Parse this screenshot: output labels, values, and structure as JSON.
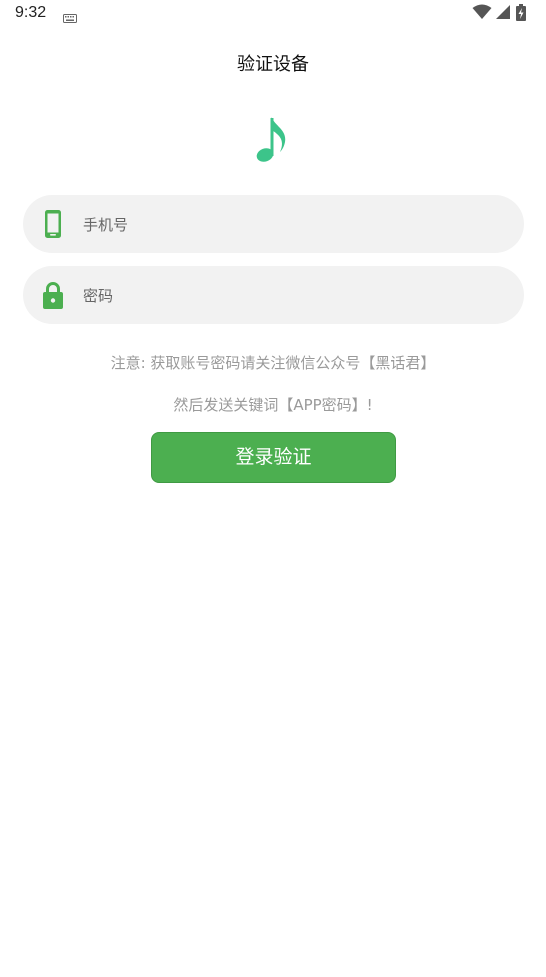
{
  "status_bar": {
    "time": "9:32",
    "icons": [
      "keyboard-icon",
      "wifi-icon",
      "signal-icon",
      "battery-charging-icon"
    ]
  },
  "header": {
    "title": "验证设备"
  },
  "logo": {
    "icon": "music-note-icon",
    "color": "#3cc48a"
  },
  "form": {
    "phone": {
      "icon": "phone-icon",
      "placeholder": "手机号",
      "value": ""
    },
    "password": {
      "icon": "lock-icon",
      "placeholder": "密码",
      "value": ""
    }
  },
  "notice": {
    "line1": "注意: 获取账号密码请关注微信公众号【黑话君】",
    "line2": "然后发送关键词【APP密码】!"
  },
  "actions": {
    "login_label": "登录验证"
  },
  "colors": {
    "accent": "#4caf50",
    "input_background": "#f2f2f2",
    "notice_text": "#9a9a9a"
  }
}
